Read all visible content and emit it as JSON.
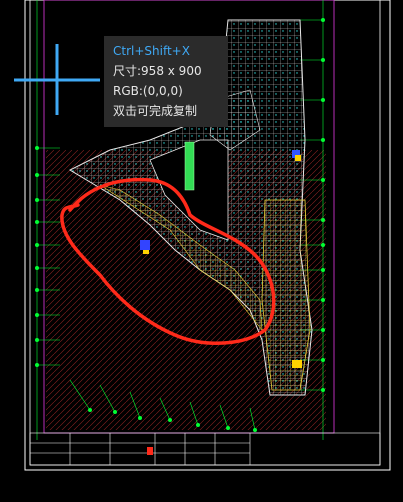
{
  "tooltip": {
    "shortcut": "Ctrl+Shift+X",
    "size_text": "尺寸:958 x 900",
    "rgb_text": "RGB:(0,0,0)",
    "hint_text": "双击可完成复制"
  },
  "colors": {
    "background": "#000000",
    "crosshair": "#3fa9f5",
    "frame": "#ffffff",
    "annotation": "#ff2a1a",
    "grid_green": "#00ff33",
    "grid_magenta": "#cc33cc",
    "plan_white": "#e8e8e8",
    "plan_yellow": "#e8d23a",
    "plan_cyan": "#35e0e0"
  },
  "icons": {
    "crosshair": "crosshair-cursor-icon"
  }
}
